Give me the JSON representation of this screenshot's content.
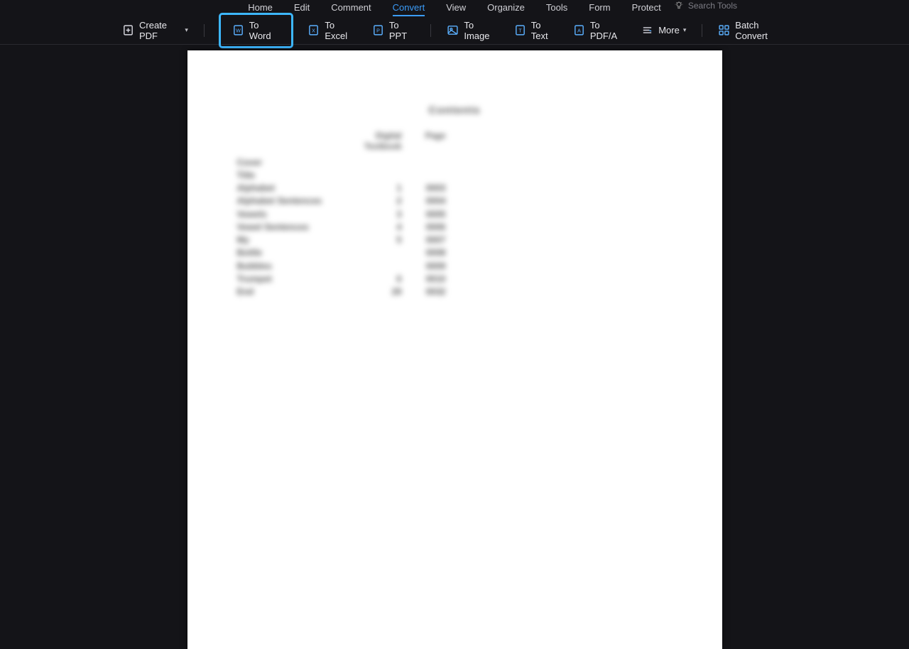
{
  "menu": {
    "items": [
      "Home",
      "Edit",
      "Comment",
      "Convert",
      "View",
      "Organize",
      "Tools",
      "Form",
      "Protect"
    ],
    "active": 3,
    "search_placeholder": "Search Tools"
  },
  "toolbar": {
    "create_pdf": "Create PDF",
    "to_word": "To Word",
    "to_excel": "To Excel",
    "to_ppt": "To PPT",
    "to_image": "To Image",
    "to_text": "To Text",
    "to_pdfa": "To PDF/A",
    "more": "More",
    "batch": "Batch Convert"
  },
  "doc": {
    "title": "Contents",
    "hcol1": "",
    "hcol2": "Digital Textbook",
    "hcol3": "Page",
    "rows": [
      {
        "c1": "Cover",
        "c2": "",
        "c3": ""
      },
      {
        "c1": "Title",
        "c2": "",
        "c3": ""
      },
      {
        "c1": "Alphabet",
        "c2": "1",
        "c3": "0003"
      },
      {
        "c1": "Alphabet Sentences",
        "c2": "2",
        "c3": "0004"
      },
      {
        "c1": "Vowels",
        "c2": "3",
        "c3": "0005"
      },
      {
        "c1": "Vowel Sentences",
        "c2": "4",
        "c3": "0006"
      },
      {
        "c1": "My",
        "c2": "5",
        "c3": "0007"
      },
      {
        "c1": "Bottle",
        "c2": "",
        "c3": "0008"
      },
      {
        "c1": "Bubbles",
        "c2": "",
        "c3": "0009"
      },
      {
        "c1": "Trumpet",
        "c2": "6",
        "c3": "0010"
      },
      {
        "c1": "End",
        "c2": "29",
        "c3": "0032"
      }
    ]
  }
}
